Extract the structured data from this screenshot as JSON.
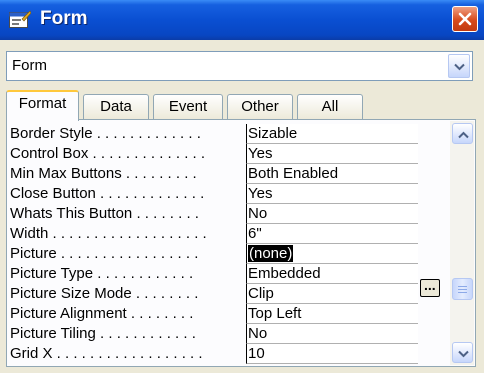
{
  "window": {
    "title": "Form",
    "icon": "form-icon"
  },
  "selector": {
    "value": "Form"
  },
  "tabs": [
    {
      "label": "Format",
      "active": true
    },
    {
      "label": "Data",
      "active": false
    },
    {
      "label": "Event",
      "active": false
    },
    {
      "label": "Other",
      "active": false
    },
    {
      "label": "All",
      "active": false
    }
  ],
  "properties": [
    {
      "name": "Border Style . . . . . . . . . . . . .",
      "value": "Sizable"
    },
    {
      "name": "Control Box . . . . . . . . . . . . . .",
      "value": "Yes"
    },
    {
      "name": "Min Max Buttons . . . . . . . . .",
      "value": "Both Enabled"
    },
    {
      "name": "Close Button . . . . . . . . . . . . .",
      "value": "Yes"
    },
    {
      "name": "Whats This Button . . . . . . . .",
      "value": "No"
    },
    {
      "name": "Width . . . . . . . . . . . . . . . . . . .",
      "value": "6\""
    },
    {
      "name": "Picture . . . . . . . . . . . . . . . . .",
      "value": "(none)",
      "selected": true
    },
    {
      "name": "Picture Type . . . . . . . . . . . .",
      "value": "Embedded"
    },
    {
      "name": "Picture Size Mode . . . . . . . .",
      "value": "Clip"
    },
    {
      "name": "Picture Alignment . . . . . . . .",
      "value": "Top Left"
    },
    {
      "name": "Picture Tiling . . . . . . . . . . . .",
      "value": "No"
    },
    {
      "name": "Grid X . . . . . . . . . . . . . . . . . .",
      "value": "10"
    }
  ],
  "builder_label": "...",
  "colors": {
    "titlebar": "#0a4fd2",
    "close": "#d64a1c",
    "tab_highlight": "#ffc83c"
  }
}
